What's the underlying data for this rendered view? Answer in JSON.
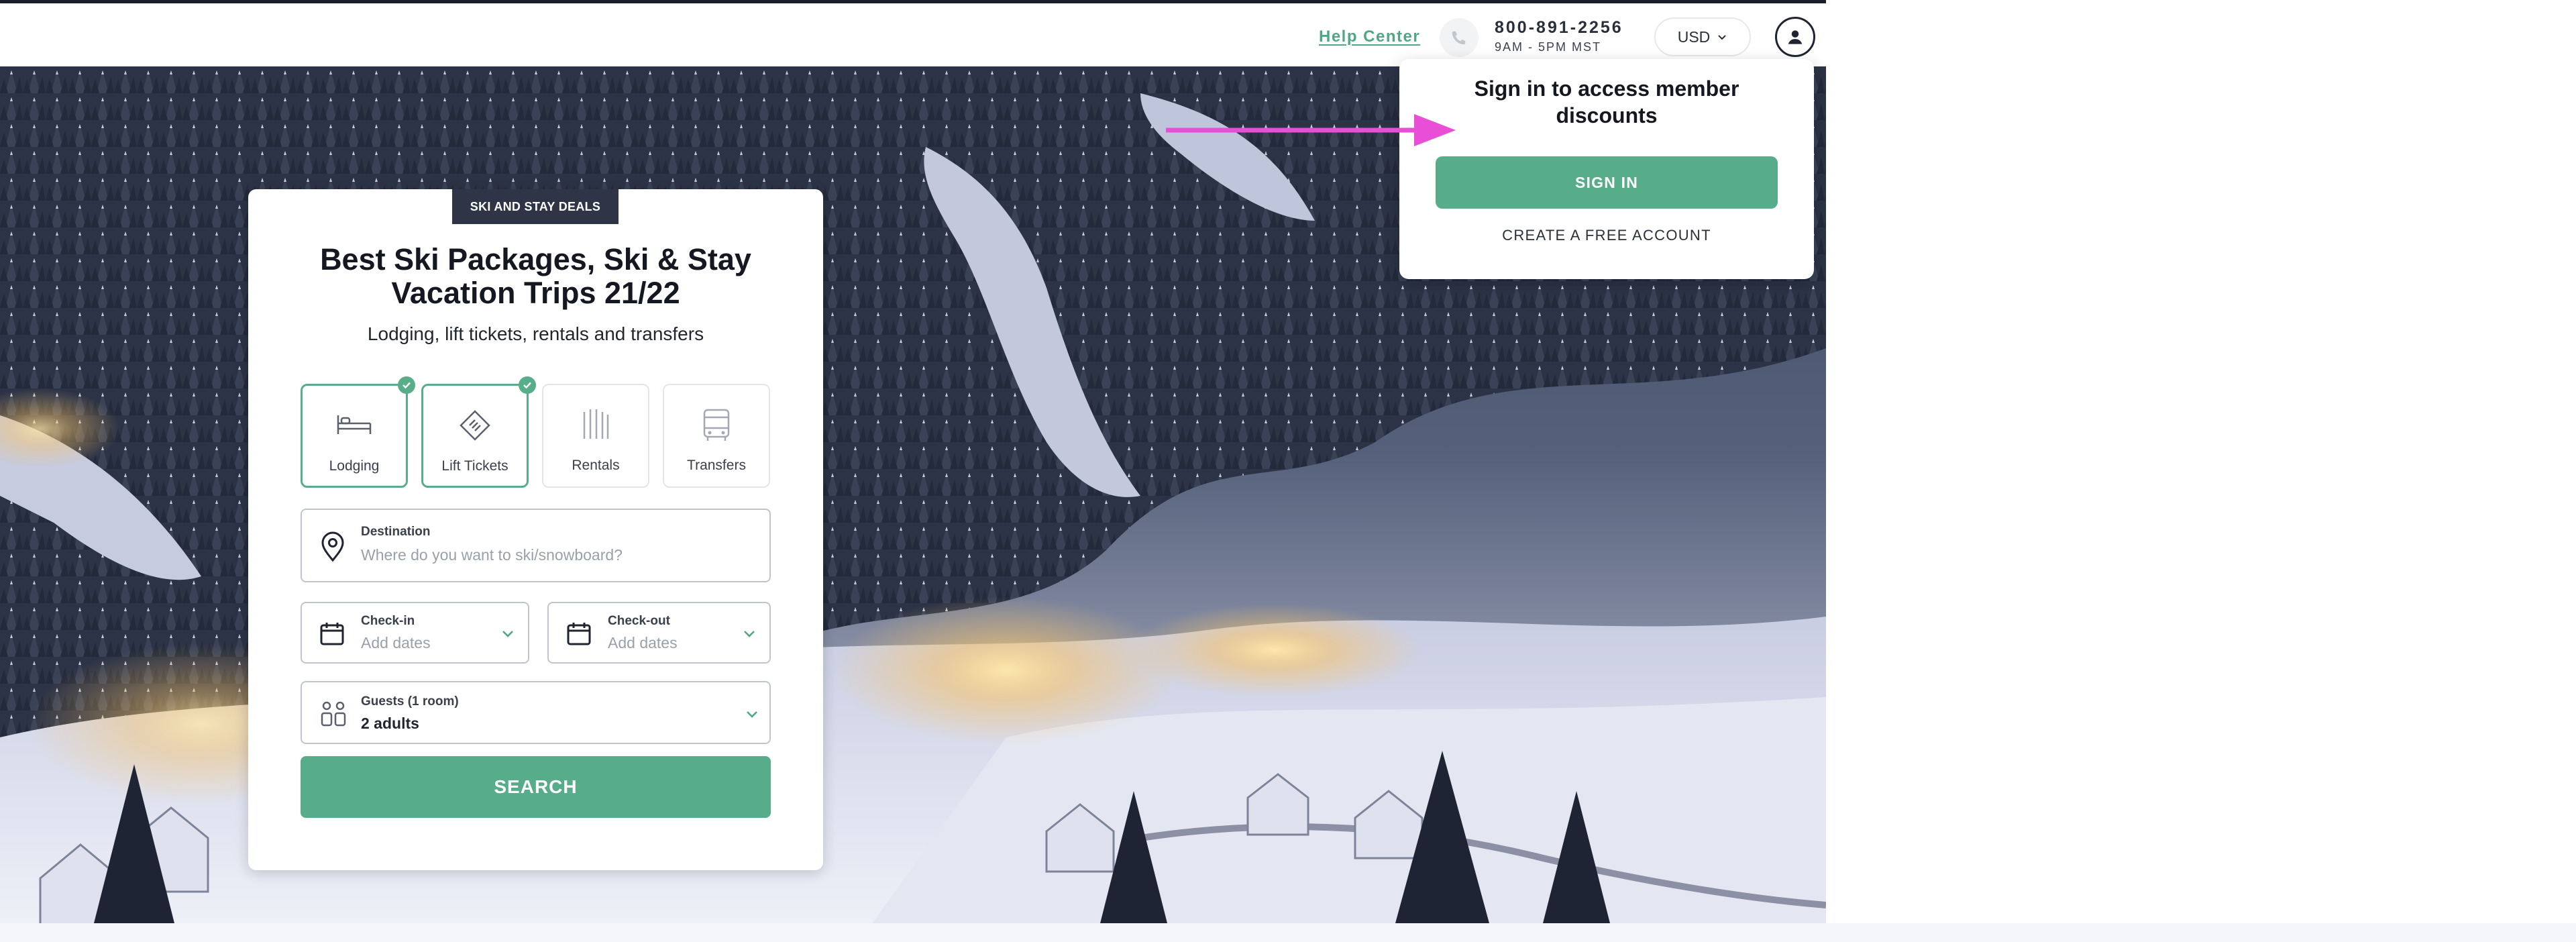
{
  "header": {
    "help_center_label": "Help Center",
    "phone_number": "800-891-2256",
    "phone_hours": "9AM - 5PM MST",
    "currency_label": "USD",
    "phone_icon": "phone-icon",
    "account_icon": "user-icon"
  },
  "search_card": {
    "badge": "SKI AND STAY DEALS",
    "title": "Best Ski Packages, Ski & Stay Vacation Trips 21/22",
    "subtitle": "Lodging, lift tickets, rentals and transfers",
    "services": [
      {
        "label": "Lodging",
        "icon": "bed-icon",
        "selected": true
      },
      {
        "label": "Lift Tickets",
        "icon": "ticket-icon",
        "selected": true
      },
      {
        "label": "Rentals",
        "icon": "skis-icon",
        "selected": false
      },
      {
        "label": "Transfers",
        "icon": "bus-icon",
        "selected": false
      }
    ],
    "destination": {
      "label": "Destination",
      "placeholder": "Where do you want to ski/snowboard?"
    },
    "check_in": {
      "label": "Check-in",
      "placeholder": "Add dates"
    },
    "check_out": {
      "label": "Check-out",
      "placeholder": "Add dates"
    },
    "guests": {
      "label": "Guests (1 room)",
      "value": "2 adults"
    },
    "search_button": "SEARCH"
  },
  "signin_popover": {
    "heading": "Sign in to access member discounts",
    "sign_in_button": "SIGN IN",
    "create_account_link": "CREATE A FREE ACCOUNT"
  },
  "colors": {
    "accent_green": "#57ad8a",
    "badge_navy": "#2f3447",
    "annotation_magenta": "#e84fd6"
  }
}
